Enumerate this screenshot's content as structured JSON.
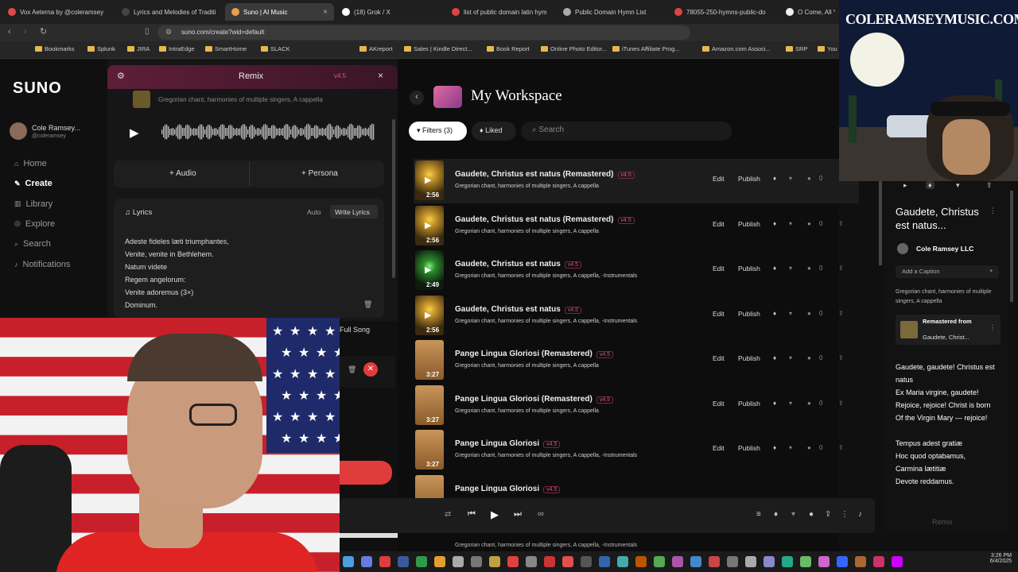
{
  "browser": {
    "tabs": [
      {
        "label": "Vox Aeterna by @coleramsey",
        "color": "#e04848"
      },
      {
        "label": "Lyrics and Melodies of Traditi",
        "color": "#444"
      },
      {
        "label": "Suno | AI Music",
        "color": "#e8a050"
      },
      {
        "label": "(18) Grok / X",
        "color": "#fff"
      },
      {
        "label": "list of public domain latin hym",
        "color": "#d44"
      },
      {
        "label": "Public Domain Hymn List",
        "color": "#aaa"
      },
      {
        "label": "78055-250-hymns-public-do",
        "color": "#d44"
      },
      {
        "label": "O Come, All Ye",
        "color": "#eee"
      }
    ],
    "url": "suno.com/create?wid=default",
    "bookmarks": [
      "Bookmarks",
      "Splunk",
      "JIRA",
      "IntraEdge",
      "SmartHome",
      "SLACK",
      "AKreport",
      "Sales | Kindle Direct...",
      "Book Report",
      "Online Photo Editor...",
      "iTunes Affiliate Prog...",
      "Amazon.com Associ...",
      "SRP",
      "You"
    ]
  },
  "nav": {
    "logo": "SUNO",
    "user_name": "Cole Ramsey...",
    "user_handle": "@coleramsey",
    "items": [
      "Home",
      "Create",
      "Library",
      "Explore",
      "Search",
      "Notifications"
    ]
  },
  "remix": {
    "title": "Remix",
    "version": "v4.5",
    "song_style": "Gregorian chant, harmonies of multiple singers, A cappella",
    "audio_label": "Audio",
    "persona_label": "Persona",
    "lyrics_label": "Lyrics",
    "auto_label": "Auto",
    "write_lyrics_label": "Write Lyrics",
    "lyrics": [
      "Adeste fideles læti triumphantes,",
      "Venite, venite in Bethlehem.",
      "Natum videte",
      "Regem angelorum:",
      "Venite adoremus (3×)",
      "Dominum."
    ],
    "full_song_label": "Full Song"
  },
  "workspace": {
    "title": "My Workspace",
    "filters_label": "Filters (3)",
    "liked_label": "Liked",
    "search_placeholder": "Search",
    "edit_label": "Edit",
    "publish_label": "Publish",
    "rows": [
      {
        "title": "Gaudete, Christus est natus (Remastered)",
        "version": "v4.5",
        "style": "Gregorian chant, harmonies of multiple singers, A cappella",
        "duration": "2:56",
        "count": "0",
        "thumb": "sun"
      },
      {
        "title": "Gaudete, Christus est natus (Remastered)",
        "version": "v4.5",
        "style": "Gregorian chant, harmonies of multiple singers, A cappella",
        "duration": "2:56",
        "count": "0",
        "thumb": "sun"
      },
      {
        "title": "Gaudete, Christus est natus",
        "version": "v4.5",
        "style": "Gregorian chant, harmonies of multiple singers, A cappella, -Instrumentals",
        "duration": "2:49",
        "count": "0",
        "thumb": "green"
      },
      {
        "title": "Gaudete, Christus est natus",
        "version": "v4.5",
        "style": "Gregorian chant, harmonies of multiple singers, A cappella, -Instrumentals",
        "duration": "2:56",
        "count": "0",
        "thumb": "sun"
      },
      {
        "title": "Pange Lingua Gloriosi (Remastered)",
        "version": "v4.5",
        "style": "Gregorian chant, harmonies of multiple singers, A cappella",
        "duration": "3:27",
        "count": "0",
        "thumb": "scroll"
      },
      {
        "title": "Pange Lingua Gloriosi (Remastered)",
        "version": "v4.5",
        "style": "Gregorian chant, harmonies of multiple singers, A cappella",
        "duration": "3:27",
        "count": "0",
        "thumb": "scroll"
      },
      {
        "title": "Pange Lingua Gloriosi",
        "version": "v4.5",
        "style": "Gregorian chant, harmonies of multiple singers, A cappella, -Instrumentals",
        "duration": "3:27",
        "count": "0",
        "thumb": "scroll"
      },
      {
        "title": "Pange Lingua Gloriosi",
        "version": "v4.5",
        "style": "",
        "duration": "",
        "count": "",
        "thumb": "scroll"
      }
    ],
    "bottom_style": "Gregorian chant, harmonies of multiple singers, A cappella, -Instrumentals"
  },
  "details": {
    "title": "Gaudete, Christus est natus...",
    "artist": "Cole Ramsey LLC",
    "caption_label": "Add a Caption",
    "style": "Gregorian chant, harmonies of multiple singers, A cappella",
    "remastered_label": "Remastered from",
    "remastered_source": "Gaudete, Christ...",
    "lyrics": [
      "Gaudete, gaudete! Christus est natus",
      "Ex Maria virgine, gaudete!",
      "Rejoice, rejoice! Christ is born",
      "Of the Virgin Mary — rejoice!",
      "",
      "Tempus adest gratiæ",
      "Hoc quod optabamus,",
      "Carmina lætitiæ",
      "Devote reddamus."
    ],
    "remix_label": "Remix"
  },
  "promo": {
    "text": "COLERAMSEYMUSIC.COM"
  },
  "taskbar": {
    "time": "3:26 PM",
    "date": "6/4/2025"
  },
  "colors": {
    "accent": "#e0508a",
    "remix_header": "#5e1e38",
    "red_button": "#e03c3c"
  }
}
